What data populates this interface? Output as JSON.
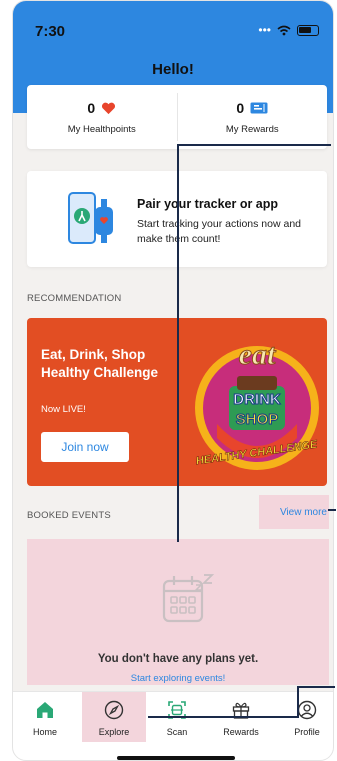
{
  "status_bar": {
    "time": "7:30",
    "signal": "•••"
  },
  "header": {
    "greeting": "Hello!"
  },
  "stats": {
    "healthpoints": {
      "value": "0",
      "label": "My Healthpoints"
    },
    "rewards": {
      "value": "0",
      "label": "My Rewards"
    }
  },
  "pair_card": {
    "title": "Pair your tracker or app",
    "description": "Start tracking your actions now and make them count!"
  },
  "recommendation": {
    "section_label": "RECOMMENDATION",
    "title": "Eat, Drink, Shop Healthy Challenge",
    "subtitle": "Now LIVE!",
    "button_label": "Join now",
    "art_words": [
      "eat",
      "DRINK",
      "SHOP",
      "HEALTHY CHALLENGE"
    ]
  },
  "booked_events": {
    "section_label": "BOOKED EVENTS",
    "view_more_label": "View more",
    "empty_message": "You don't have any plans yet.",
    "empty_link": "Start exploring events!"
  },
  "tabbar": {
    "items": [
      {
        "label": "Home",
        "icon": "home-icon"
      },
      {
        "label": "Explore",
        "icon": "compass-icon"
      },
      {
        "label": "Scan",
        "icon": "scan-icon"
      },
      {
        "label": "Rewards",
        "icon": "gift-icon"
      },
      {
        "label": "Profile",
        "icon": "profile-icon"
      }
    ]
  },
  "colors": {
    "brand_blue": "#2d87e0",
    "promo_orange": "#e24e23",
    "highlight_pink": "#f3d5dc",
    "heart_red": "#e8452c",
    "home_green": "#2aa876"
  }
}
